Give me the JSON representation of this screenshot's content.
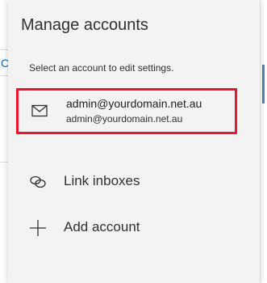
{
  "panel": {
    "title": "Manage accounts",
    "subtitle": "Select an account to edit settings."
  },
  "account": {
    "display_name": "admin@yourdomain.net.au",
    "email": "admin@yourdomain.net.au",
    "highlight_color": "#e8162e"
  },
  "actions": {
    "link_inboxes": "Link inboxes",
    "add_account": "Add account"
  },
  "background": {
    "left_fragment": "C"
  },
  "icons": {
    "account": "mail-icon",
    "link_inboxes": "link-icon",
    "add_account": "plus-icon"
  }
}
